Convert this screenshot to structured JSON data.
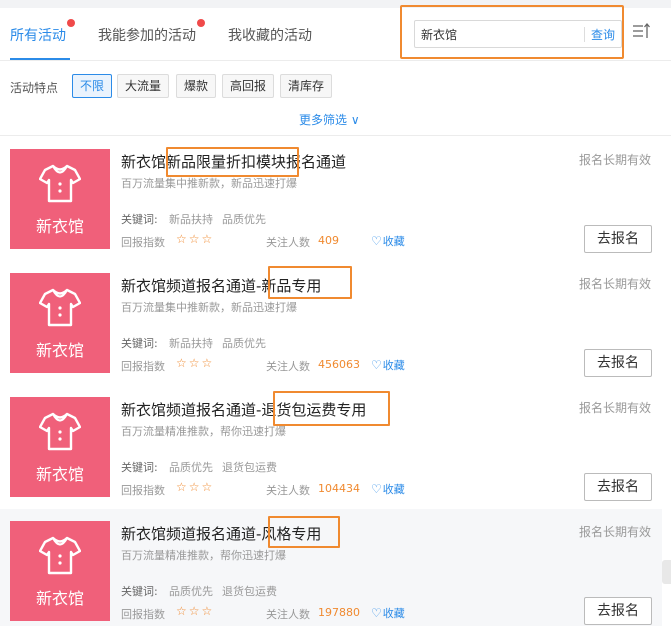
{
  "tabs": [
    {
      "label": "所有活动",
      "active": true,
      "has_dot": true
    },
    {
      "label": "我能参加的活动",
      "active": false,
      "has_dot": true
    },
    {
      "label": "我收藏的活动",
      "active": false,
      "has_dot": false
    }
  ],
  "search": {
    "value": "新衣馆",
    "button": "查询"
  },
  "filters": {
    "label": "活动特点",
    "chips": [
      "不限",
      "大流量",
      "爆款",
      "高回报",
      "清库存"
    ],
    "active_chip": "不限",
    "more": "更多筛选"
  },
  "labels": {
    "keywords": "关键词:",
    "return_index": "回报指数",
    "followers": "关注人数",
    "favorite": "收藏",
    "join": "去报名",
    "thumb_text": "新衣馆"
  },
  "colors": {
    "accent": "#2b8be8",
    "highlight": "#f08a30",
    "thumb": "#f0607a"
  },
  "activities": [
    {
      "title": "新衣馆新品限量折扣模块报名通道",
      "subtitle": "百万流量集中推新款，新品迅速打爆",
      "keywords": [
        "新品扶持",
        "品质优先"
      ],
      "stars": "☆☆☆",
      "followers": "409",
      "status": "报名长期有效"
    },
    {
      "title": "新衣馆频道报名通道-新品专用",
      "subtitle": "百万流量集中推新款，新品迅速打爆",
      "keywords": [
        "新品扶持",
        "品质优先"
      ],
      "stars": "☆☆☆",
      "followers": "456063",
      "status": "报名长期有效"
    },
    {
      "title": "新衣馆频道报名通道-退货包运费专用",
      "subtitle": "百万流量精准推款，帮你迅速打爆",
      "keywords": [
        "品质优先",
        "退货包运费"
      ],
      "stars": "☆☆☆",
      "followers": "104434",
      "status": "报名长期有效"
    },
    {
      "title": "新衣馆频道报名通道-风格专用",
      "subtitle": "百万流量精准推款，帮你迅速打爆",
      "keywords": [
        "品质优先",
        "退货包运费"
      ],
      "stars": "☆☆☆",
      "followers": "197880",
      "status": "报名长期有效"
    }
  ]
}
